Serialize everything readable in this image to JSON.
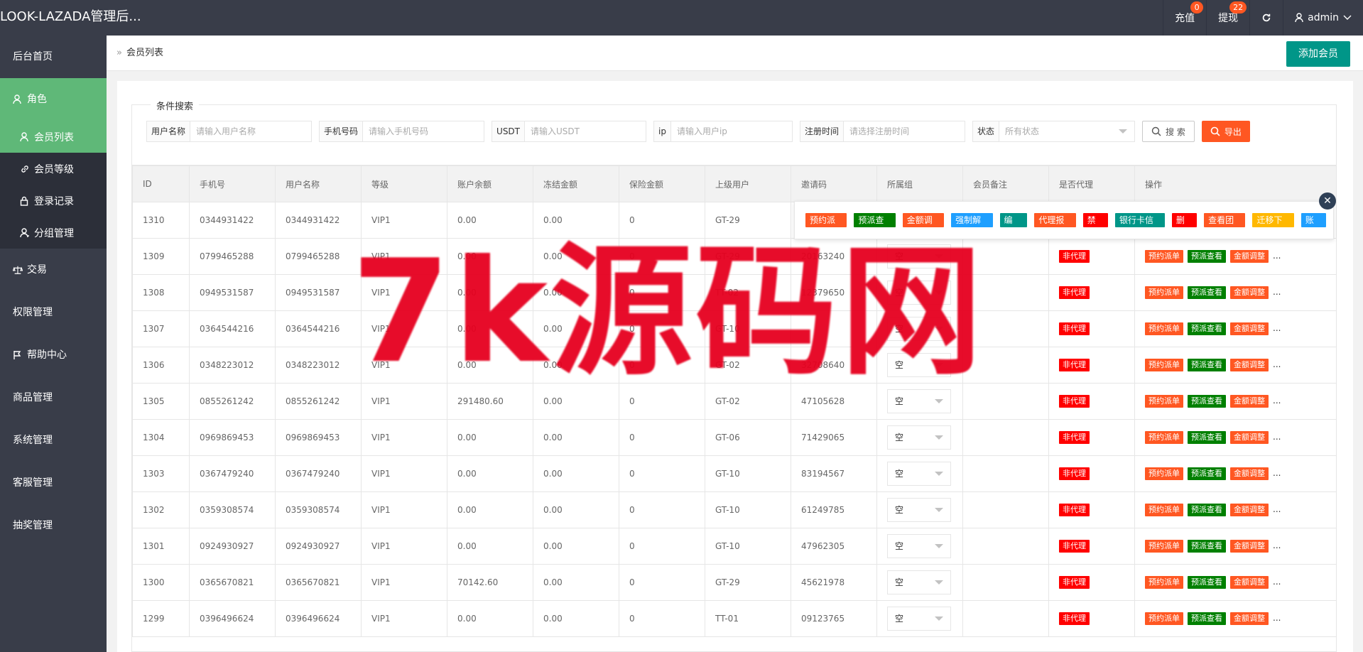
{
  "topbar": {
    "logo": "LOOK-LAZADA管理后...",
    "recharge_label": "充值",
    "recharge_badge": "0",
    "withdraw_label": "提现",
    "withdraw_badge": "22",
    "user_label": "admin"
  },
  "sidebar": {
    "home": "后台首页",
    "role": "角色",
    "sub": {
      "member_list": "会员列表",
      "member_level": "会员等级",
      "login_log": "登录记录",
      "group_manage": "分组管理"
    },
    "trade": "交易",
    "perm": "权限管理",
    "help": "帮助中心",
    "goods": "商品管理",
    "system": "系统管理",
    "cs": "客服管理",
    "lottery": "抽奖管理"
  },
  "header": {
    "breadcrumb": "会员列表",
    "add_button": "添加会员"
  },
  "search": {
    "legend": "条件搜索",
    "username_label": "用户名称",
    "username_placeholder": "请输入用户名称",
    "phone_label": "手机号码",
    "phone_placeholder": "请输入手机号码",
    "usdt_label": "USDT",
    "usdt_placeholder": "请输入USDT",
    "ip_label": "ip",
    "ip_placeholder": "请输入用户ip",
    "regtime_label": "注册时间",
    "regtime_placeholder": "请选择注册时间",
    "status_label": "状态",
    "status_value": "所有状态",
    "search_button": "搜 索",
    "export_button": "导出"
  },
  "table": {
    "headers": [
      "ID",
      "手机号",
      "用户名称",
      "等级",
      "账户余额",
      "冻结金额",
      "保险金额",
      "上级用户",
      "邀请码",
      "所属组",
      "会员备注",
      "是否代理",
      "操作"
    ],
    "group_value": "空",
    "agent_tag": "非代理",
    "action_tags": [
      "预约派单",
      "预派查看",
      "金额调整"
    ],
    "more": "...",
    "rows": [
      {
        "id": "1310",
        "phone": "0344931422",
        "name": "0344931422",
        "level": "VIP1",
        "balance": "0.00",
        "frozen": "0.00",
        "insurance": "0",
        "parent": "GT-29",
        "code": ""
      },
      {
        "id": "1309",
        "phone": "0799465288",
        "name": "0799465288",
        "level": "VIP1",
        "balance": "0.00",
        "frozen": "0.00",
        "insurance": "0",
        "parent": "GT-29",
        "code": "20163240"
      },
      {
        "id": "1308",
        "phone": "0949531587",
        "name": "0949531587",
        "level": "VIP1",
        "balance": "0.00",
        "frozen": "0.00",
        "insurance": "0",
        "parent": "TT-02",
        "code": "12379650"
      },
      {
        "id": "1307",
        "phone": "0364544216",
        "name": "0364544216",
        "level": "VIP1",
        "balance": "0.00",
        "frozen": "0.00",
        "insurance": "0",
        "parent": "GT-10",
        "code": ""
      },
      {
        "id": "1306",
        "phone": "0348223012",
        "name": "0348223012",
        "level": "VIP1",
        "balance": "0.00",
        "frozen": "0.00",
        "insurance": "0",
        "parent": "GT-02",
        "code": "32708640"
      },
      {
        "id": "1305",
        "phone": "0855261242",
        "name": "0855261242",
        "level": "VIP1",
        "balance": "291480.60",
        "frozen": "0.00",
        "insurance": "0",
        "parent": "GT-02",
        "code": "47105628"
      },
      {
        "id": "1304",
        "phone": "0969869453",
        "name": "0969869453",
        "level": "VIP1",
        "balance": "0.00",
        "frozen": "0.00",
        "insurance": "0",
        "parent": "GT-06",
        "code": "71429065"
      },
      {
        "id": "1303",
        "phone": "0367479240",
        "name": "0367479240",
        "level": "VIP1",
        "balance": "0.00",
        "frozen": "0.00",
        "insurance": "0",
        "parent": "GT-10",
        "code": "83194567"
      },
      {
        "id": "1302",
        "phone": "0359308574",
        "name": "0359308574",
        "level": "VIP1",
        "balance": "0.00",
        "frozen": "0.00",
        "insurance": "0",
        "parent": "GT-10",
        "code": "61249785"
      },
      {
        "id": "1301",
        "phone": "0924930927",
        "name": "0924930927",
        "level": "VIP1",
        "balance": "0.00",
        "frozen": "0.00",
        "insurance": "0",
        "parent": "GT-10",
        "code": "47962305"
      },
      {
        "id": "1300",
        "phone": "0365670821",
        "name": "0365670821",
        "level": "VIP1",
        "balance": "70142.60",
        "frozen": "0.00",
        "insurance": "0",
        "parent": "GT-29",
        "code": "45621978"
      },
      {
        "id": "1299",
        "phone": "0396496624",
        "name": "0396496624",
        "level": "VIP1",
        "balance": "0.00",
        "frozen": "0.00",
        "insurance": "0",
        "parent": "TT-01",
        "code": "09123765"
      }
    ]
  },
  "popup": {
    "actions": [
      {
        "label": "预约派单",
        "color": "#FF5722"
      },
      {
        "label": "预派查看",
        "color": "#008000"
      },
      {
        "label": "金额调整",
        "color": "#FF5722"
      },
      {
        "label": "强制解冻",
        "color": "#1E9FFF"
      },
      {
        "label": "编 辑",
        "color": "#009688"
      },
      {
        "label": "代理报表",
        "color": "#FF5722"
      },
      {
        "label": "禁用",
        "color": "#FF0000"
      },
      {
        "label": "银行卡信息",
        "color": "#009688"
      },
      {
        "label": "删除",
        "color": "#FF0000"
      },
      {
        "label": "查看团队",
        "color": "#FF5722"
      },
      {
        "label": "迁移下级",
        "color": "#FFB800"
      },
      {
        "label": "账变",
        "color": "#1E9FFF"
      }
    ],
    "close": "✕"
  },
  "watermark": "7k源码网"
}
